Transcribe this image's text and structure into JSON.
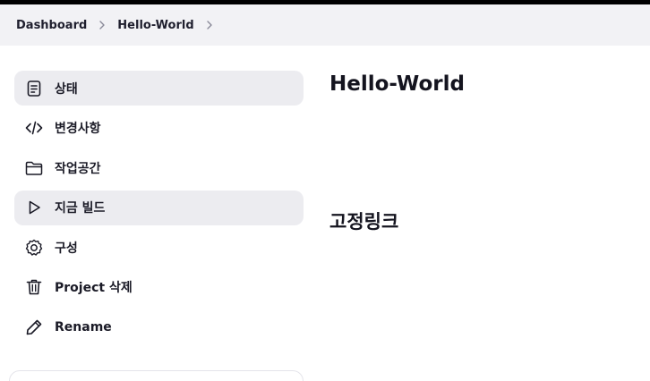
{
  "breadcrumb": {
    "items": [
      {
        "label": "Dashboard"
      },
      {
        "label": "Hello-World"
      }
    ]
  },
  "sidebar": {
    "items": [
      {
        "label": "상태",
        "icon": "document-icon",
        "active": true
      },
      {
        "label": "변경사항",
        "icon": "code-icon",
        "active": false
      },
      {
        "label": "작업공간",
        "icon": "folder-icon",
        "active": false
      },
      {
        "label": "지금 빌드",
        "icon": "play-icon",
        "active": true
      },
      {
        "label": "구성",
        "icon": "gear-icon",
        "active": false
      },
      {
        "label": "Project 삭제",
        "icon": "trash-icon",
        "active": false
      },
      {
        "label": "Rename",
        "icon": "pencil-icon",
        "active": false
      }
    ]
  },
  "main": {
    "title": "Hello-World",
    "permalinks_heading": "고정링크"
  }
}
